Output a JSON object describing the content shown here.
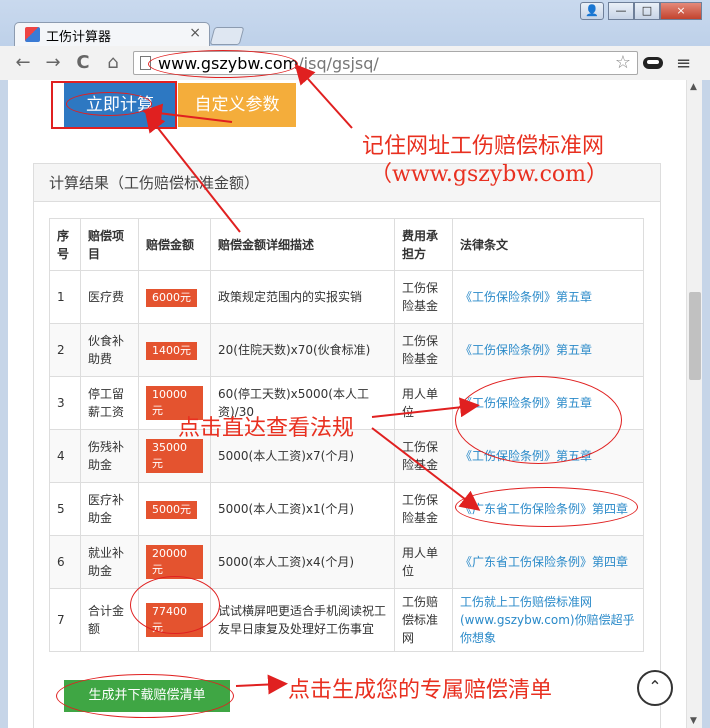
{
  "browser": {
    "tab_title": "工伤计算器",
    "tab_close": "×",
    "url_host": "www.gszybw.com",
    "url_path": "/jsq/gsjsq/",
    "back_icon": "←",
    "forward_icon": "→",
    "reload_icon": "C",
    "home_icon": "⌂",
    "star_icon": "☆",
    "menu_icon": "≡",
    "window_minimize": "—",
    "window_maximize": "□",
    "window_close": "×"
  },
  "buttons": {
    "compute": "立即计算",
    "custom": "自定义参数",
    "generate": "生成并下载赔偿清单",
    "backtop": "⌃"
  },
  "panel": {
    "title": "计算结果（工伤赔偿标准金额）"
  },
  "table": {
    "headers": [
      "序号",
      "赔偿项目",
      "赔偿金额",
      "赔偿金额详细描述",
      "费用承担方",
      "法律条文"
    ],
    "rows": [
      {
        "idx": "1",
        "item": "医疗费",
        "amount": "6000元",
        "desc": "政策规定范围内的实报实销",
        "bearer": "工伤保险基金",
        "law": "《工伤保险条例》第五章"
      },
      {
        "idx": "2",
        "item": "伙食补助费",
        "amount": "1400元",
        "desc": "20(住院天数)x70(伙食标准)",
        "bearer": "工伤保险基金",
        "law": "《工伤保险条例》第五章"
      },
      {
        "idx": "3",
        "item": "停工留薪工资",
        "amount": "10000元",
        "desc": "60(停工天数)x5000(本人工资)/30",
        "bearer": "用人单位",
        "law": "《工伤保险条例》第五章"
      },
      {
        "idx": "4",
        "item": "伤残补助金",
        "amount": "35000元",
        "desc": "5000(本人工资)x7(个月)",
        "bearer": "工伤保险基金",
        "law": "《工伤保险条例》第五章"
      },
      {
        "idx": "5",
        "item": "医疗补助金",
        "amount": "5000元",
        "desc": "5000(本人工资)x1(个月)",
        "bearer": "工伤保险基金",
        "law": "《广东省工伤保险条例》第四章"
      },
      {
        "idx": "6",
        "item": "就业补助金",
        "amount": "20000元",
        "desc": "5000(本人工资)x4(个月)",
        "bearer": "用人单位",
        "law": "《广东省工伤保险条例》第四章"
      },
      {
        "idx": "7",
        "item": "合计金额",
        "amount": "77400元",
        "desc": "试试横屏吧更适合手机阅读祝工友早日康复及处理好工伤事宜",
        "bearer": "工伤赔偿标准网",
        "law": "工伤就上工伤赔偿标准网(www.gszybw.com)你赔偿超乎你想象"
      }
    ]
  },
  "annotations": {
    "remember_line1": "记住网址工伤赔偿标准网",
    "remember_line2": "（www.gszybw.com）",
    "click_law": "点击直达查看法规",
    "click_generate": "点击生成您的专属赔偿清单"
  },
  "colors": {
    "compute_button": "#2d78c2",
    "custom_button": "#f4ad3b",
    "amount_badge": "#e4532f",
    "generate_button": "#3fa644",
    "annotation_red": "#e83020",
    "law_link": "#2a8ac9"
  }
}
